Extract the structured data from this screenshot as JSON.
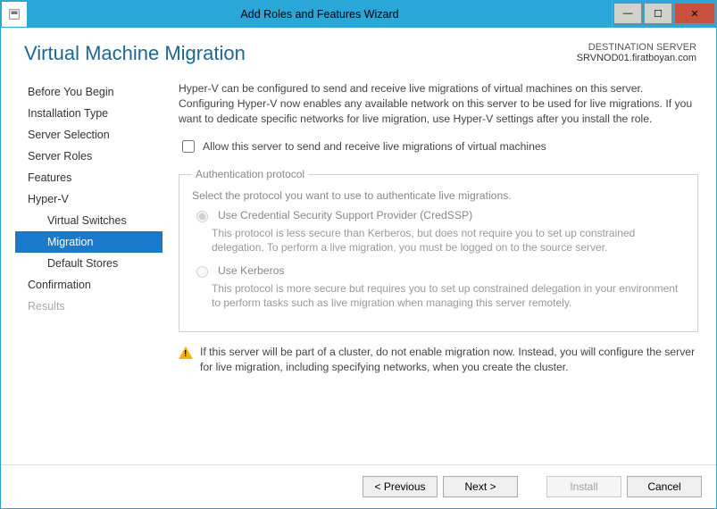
{
  "window": {
    "title": "Add Roles and Features Wizard"
  },
  "header": {
    "pageTitle": "Virtual Machine Migration",
    "destLabel": "DESTINATION SERVER",
    "destValue": "SRVNOD01.firatboyan.com"
  },
  "nav": {
    "items": [
      {
        "label": "Before You Begin",
        "selected": false,
        "sub": false,
        "disabled": false
      },
      {
        "label": "Installation Type",
        "selected": false,
        "sub": false,
        "disabled": false
      },
      {
        "label": "Server Selection",
        "selected": false,
        "sub": false,
        "disabled": false
      },
      {
        "label": "Server Roles",
        "selected": false,
        "sub": false,
        "disabled": false
      },
      {
        "label": "Features",
        "selected": false,
        "sub": false,
        "disabled": false
      },
      {
        "label": "Hyper-V",
        "selected": false,
        "sub": false,
        "disabled": false
      },
      {
        "label": "Virtual Switches",
        "selected": false,
        "sub": true,
        "disabled": false
      },
      {
        "label": "Migration",
        "selected": true,
        "sub": true,
        "disabled": false
      },
      {
        "label": "Default Stores",
        "selected": false,
        "sub": true,
        "disabled": false
      },
      {
        "label": "Confirmation",
        "selected": false,
        "sub": false,
        "disabled": false
      },
      {
        "label": "Results",
        "selected": false,
        "sub": false,
        "disabled": true
      }
    ]
  },
  "main": {
    "intro": "Hyper-V can be configured to send and receive live migrations of virtual machines on this server. Configuring Hyper-V now enables any available network on this server to be used for live migrations. If you want to dedicate specific networks for live migration, use Hyper-V settings after you install the role.",
    "checkboxLabel": "Allow this server to send and receive live migrations of virtual machines",
    "fieldset": {
      "legend": "Authentication protocol",
      "desc": "Select the protocol you want to use to authenticate live migrations.",
      "opt1Label": "Use Credential Security Support Provider (CredSSP)",
      "opt1Desc": "This protocol is less secure than Kerberos, but does not require you to set up constrained delegation. To perform a live migration, you must be logged on to the source server.",
      "opt2Label": "Use Kerberos",
      "opt2Desc": "This protocol is more secure but requires you to set up constrained delegation in your environment to perform tasks such as live migration when managing this server remotely."
    },
    "warning": "If this server will be part of a cluster, do not enable migration now. Instead, you will configure the server for live migration, including specifying networks, when you create the cluster."
  },
  "footer": {
    "previous": "< Previous",
    "next": "Next >",
    "install": "Install",
    "cancel": "Cancel"
  }
}
